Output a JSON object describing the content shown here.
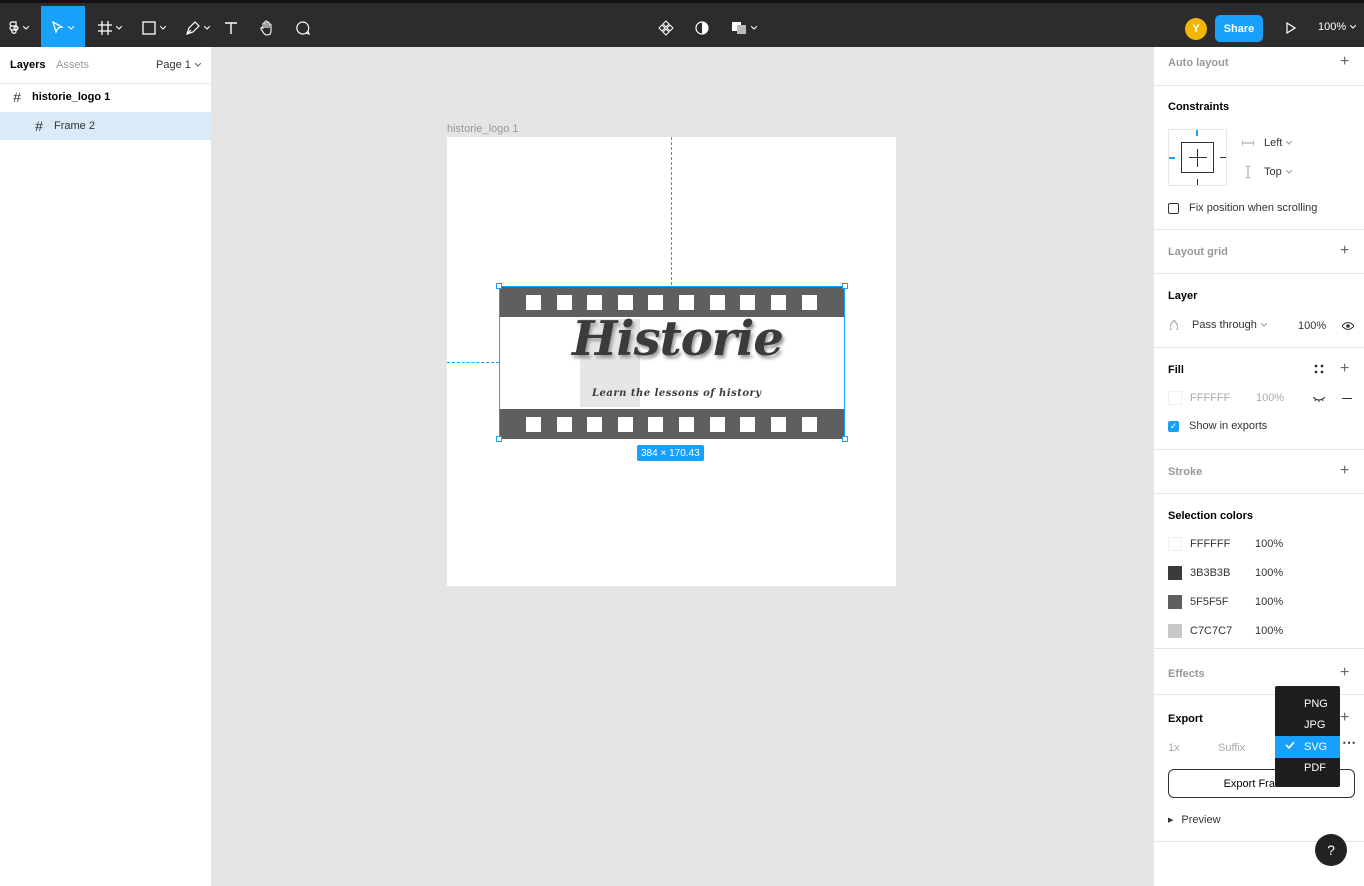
{
  "toolbar": {
    "share_label": "Share",
    "zoom_label": "100%",
    "avatar_initial": "Y",
    "accent_color": "#18a0fb"
  },
  "left_panel": {
    "tabs": [
      "Layers",
      "Assets"
    ],
    "page_label": "Page 1",
    "layers": [
      {
        "name": "historie_logo 1",
        "selected": false
      },
      {
        "name": "Frame 2",
        "selected": true
      }
    ]
  },
  "canvas": {
    "frame_label": "historie_logo 1",
    "logo_title": "Historie",
    "logo_tagline": "Learn the lessons of history",
    "dimensions": "384 × 170.43"
  },
  "right_panel": {
    "auto_layout": "Auto layout",
    "constraints": {
      "title": "Constraints",
      "horizontal": "Left",
      "vertical": "Top",
      "fix_position": "Fix position when scrolling"
    },
    "layout_grid": "Layout grid",
    "layer": {
      "title": "Layer",
      "blend": "Pass through",
      "opacity": "100%"
    },
    "fill": {
      "title": "Fill",
      "hex": "FFFFFF",
      "opacity": "100%",
      "show_in_exports": "Show in exports"
    },
    "stroke": "Stroke",
    "selection_colors": {
      "title": "Selection colors",
      "items": [
        {
          "hex": "FFFFFF",
          "opacity": "100%",
          "color": "#ffffff"
        },
        {
          "hex": "3B3B3B",
          "opacity": "100%",
          "color": "#3b3b3b"
        },
        {
          "hex": "5F5F5F",
          "opacity": "100%",
          "color": "#5f5f5f"
        },
        {
          "hex": "C7C7C7",
          "opacity": "100%",
          "color": "#c7c7c7"
        }
      ]
    },
    "effects": "Effects",
    "export": {
      "title": "Export",
      "scale": "1x",
      "suffix_placeholder": "Suffix",
      "button": "Export Frame 2",
      "preview": "Preview"
    }
  },
  "format_menu": {
    "options": [
      "PNG",
      "JPG",
      "SVG",
      "PDF"
    ],
    "selected": "SVG"
  },
  "help_label": "?"
}
